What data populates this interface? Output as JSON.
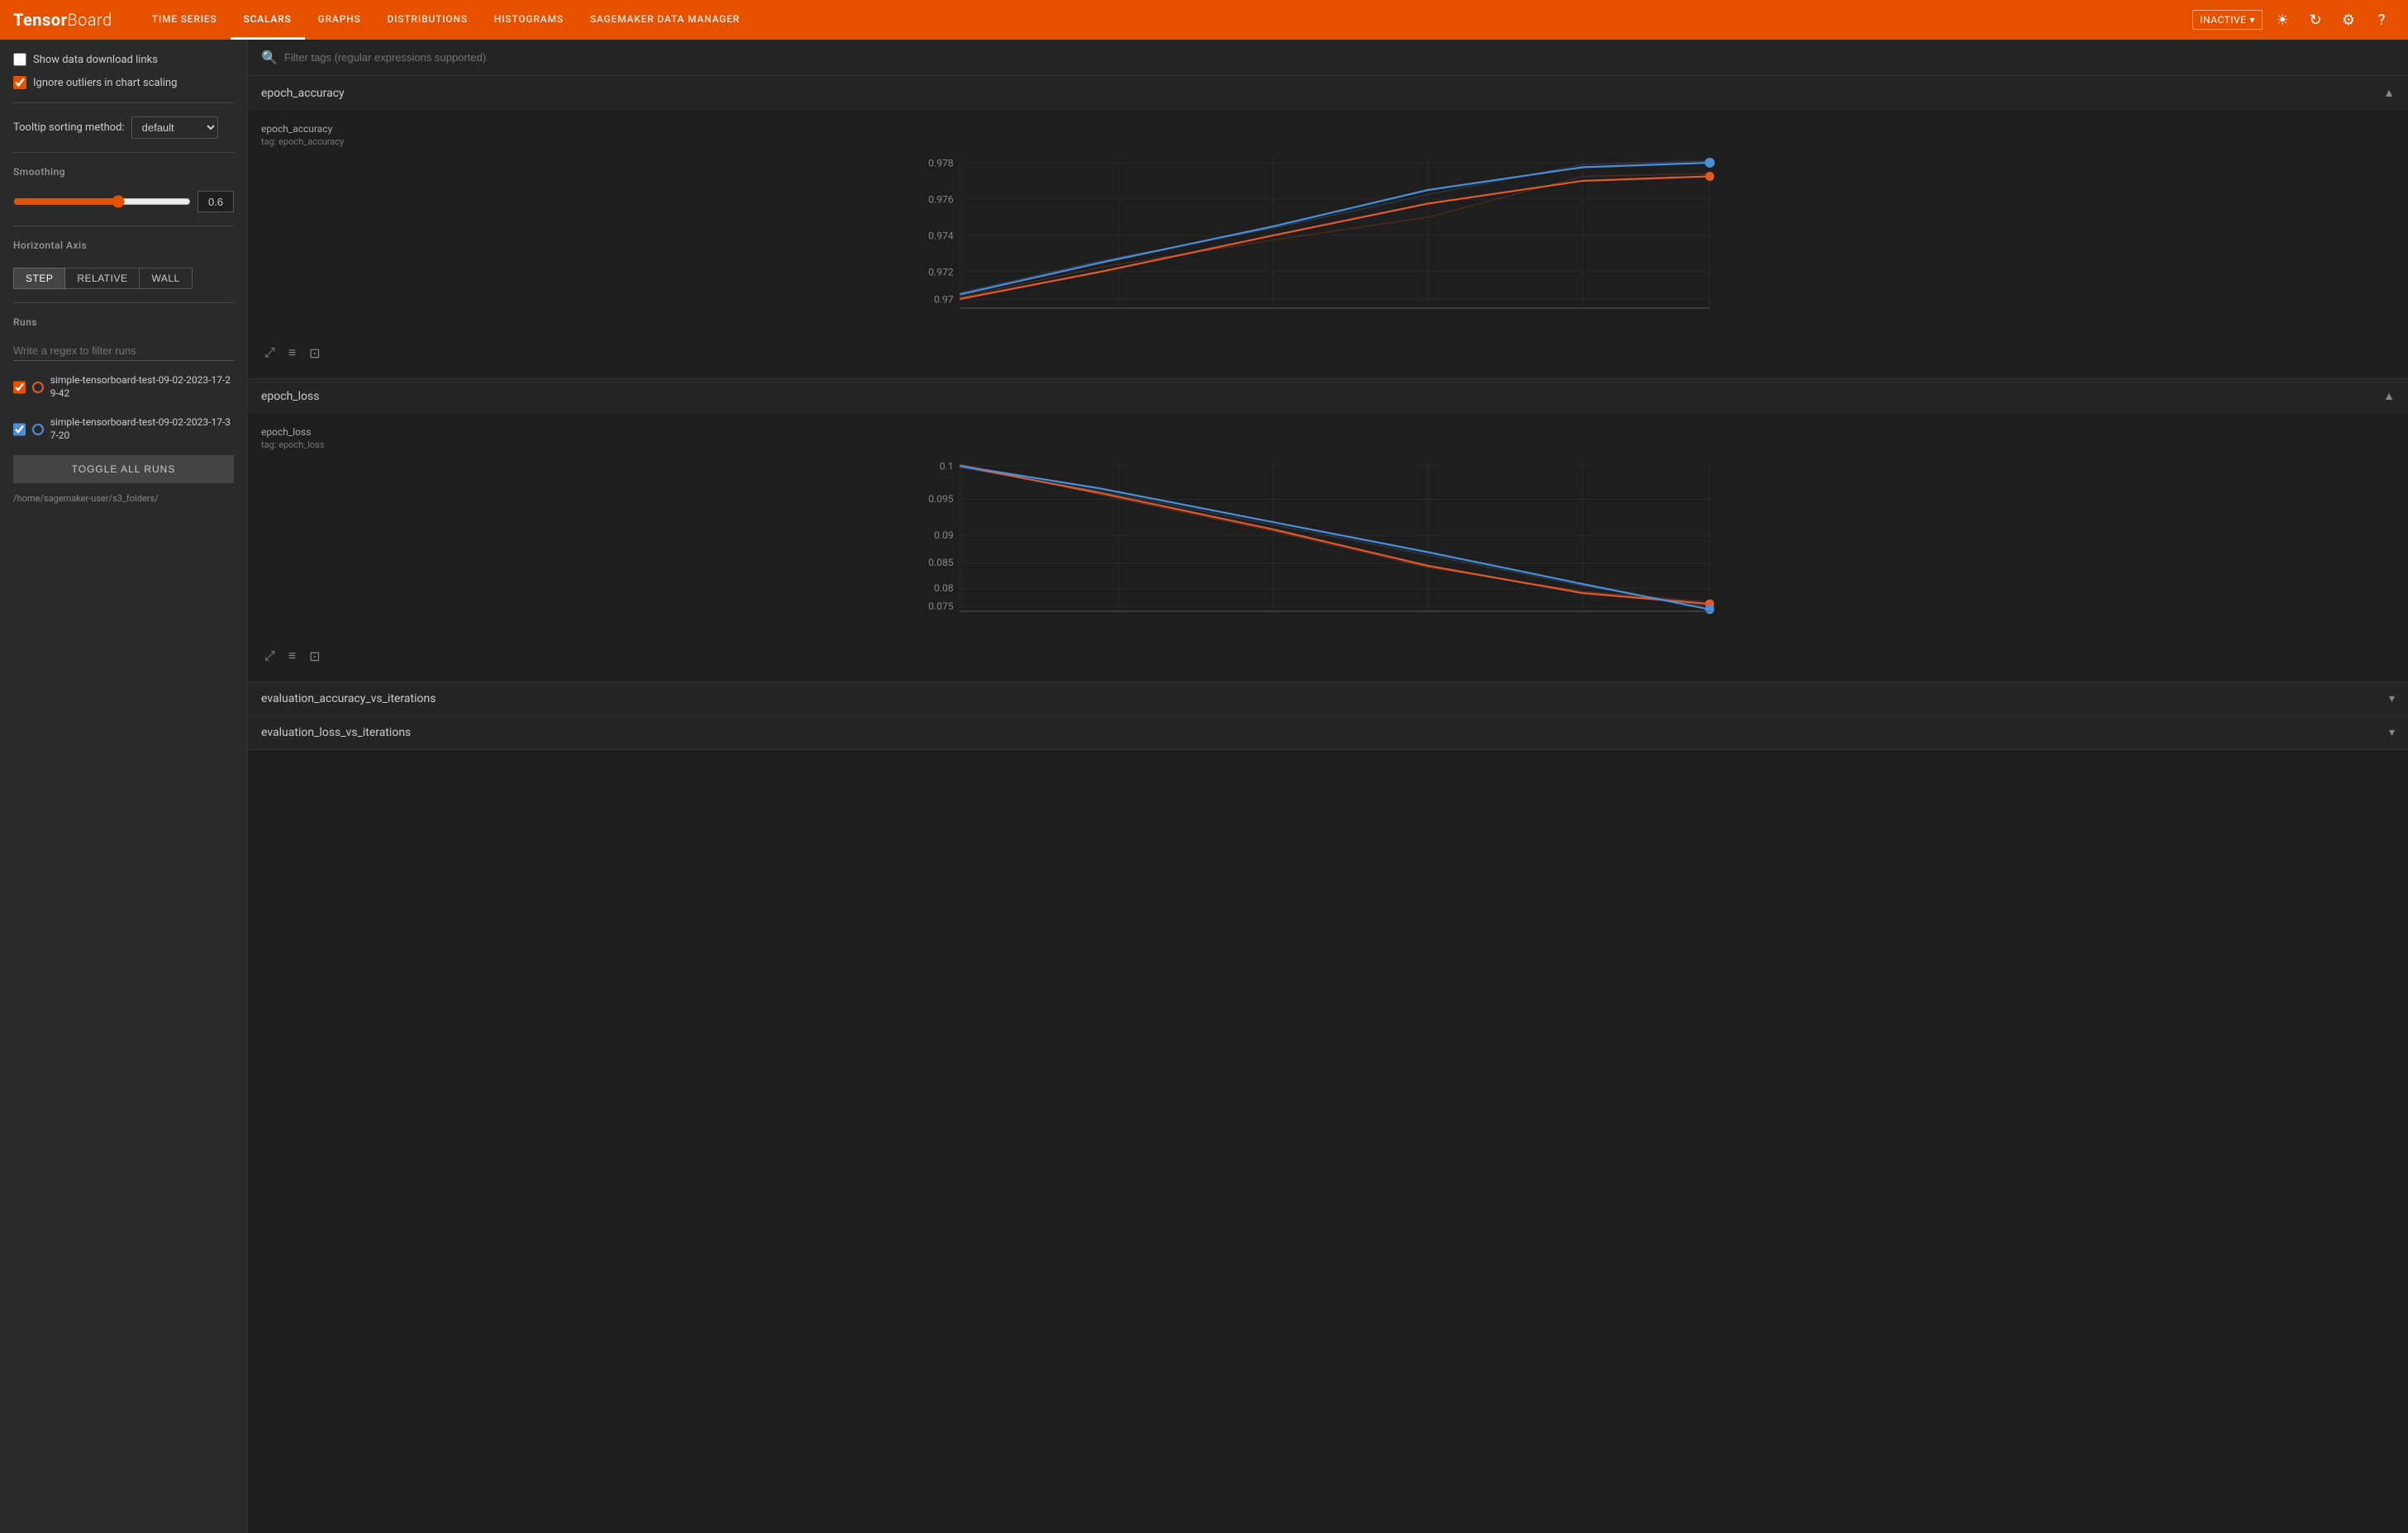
{
  "header": {
    "logo_text1": "Tensor",
    "logo_text2": "Board",
    "nav_items": [
      {
        "label": "TIME SERIES",
        "active": false
      },
      {
        "label": "SCALARS",
        "active": true
      },
      {
        "label": "GRAPHS",
        "active": false
      },
      {
        "label": "DISTRIBUTIONS",
        "active": false
      },
      {
        "label": "HISTOGRAMS",
        "active": false
      },
      {
        "label": "SAGEMAKER DATA MANAGER",
        "active": false
      }
    ],
    "status": "INACTIVE",
    "icons": [
      "brightness",
      "refresh",
      "settings",
      "help"
    ]
  },
  "sidebar": {
    "show_data_links_label": "Show data download links",
    "ignore_outliers_label": "Ignore outliers in chart scaling",
    "tooltip_label": "Tooltip sorting method:",
    "tooltip_value": "default",
    "smoothing_label": "Smoothing",
    "smoothing_value": "0.6",
    "axis_label": "Horizontal Axis",
    "axis_options": [
      "STEP",
      "RELATIVE",
      "WALL"
    ],
    "axis_active": "STEP",
    "runs_label": "Runs",
    "runs_filter_placeholder": "Write a regex to filter runs",
    "runs": [
      {
        "name": "simple-tensorboard-test-09-02-2023-17-29-42",
        "checked": true,
        "color": "red"
      },
      {
        "name": "simple-tensorboard-test-09-02-2023-17-37-20",
        "checked": true,
        "color": "blue"
      }
    ],
    "toggle_all_label": "TOGGLE ALL RUNS",
    "folder_path": "/home/sagemaker-user/s3_folders/"
  },
  "main": {
    "filter_placeholder": "Filter tags (regular expressions supported)",
    "sections": [
      {
        "title": "epoch_accuracy",
        "expanded": true,
        "chart_title": "epoch_accuracy",
        "chart_subtitle": "tag: epoch_accuracy",
        "y_min": "0.97",
        "y_max": "0.978",
        "type": "accuracy"
      },
      {
        "title": "epoch_loss",
        "expanded": true,
        "chart_title": "epoch_loss",
        "chart_subtitle": "tag: epoch_loss",
        "y_min": "0.075",
        "y_max": "0.1",
        "type": "loss"
      },
      {
        "title": "evaluation_accuracy_vs_iterations",
        "expanded": false
      },
      {
        "title": "evaluation_loss_vs_iterations",
        "expanded": false
      }
    ],
    "chart_actions": [
      "expand-icon",
      "list-icon",
      "image-icon"
    ]
  }
}
